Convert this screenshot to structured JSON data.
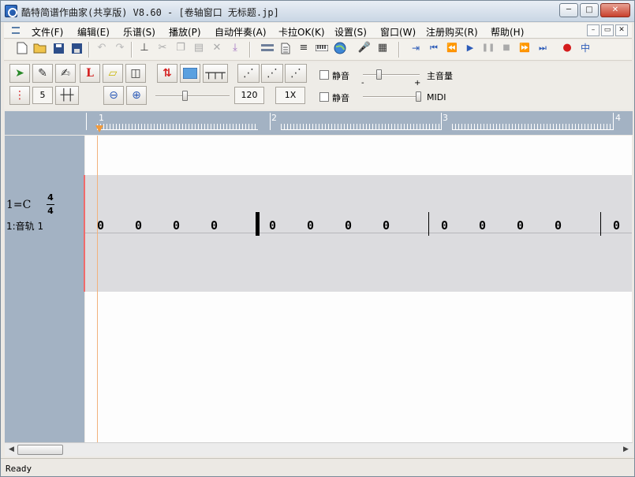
{
  "window": {
    "title": "酷特简谱作曲家(共享版) V8.60 - [卷轴窗口  无标题.jp]",
    "controls": [
      "─",
      "□",
      "✕"
    ]
  },
  "menubar": {
    "items": [
      "文件(F)",
      "编辑(E)",
      "乐谱(S)",
      "播放(P)",
      "自动伴奏(A)",
      "卡拉OK(K)",
      "设置(S)",
      "窗口(W)",
      "注册购买(R)",
      "帮助(H)"
    ],
    "mdi_controls": [
      "–",
      "▭",
      "✕"
    ]
  },
  "toolbar2": {
    "grid_value": "5",
    "tempo_value": "120",
    "speed_value": "1X",
    "mute1_label": "静音",
    "mute2_label": "静音",
    "master_volume_label": "主音量",
    "midi_label": "MIDI",
    "minus_label": "-",
    "plus_label": "+"
  },
  "ruler": {
    "measures": [
      "1",
      "2",
      "3",
      "4"
    ]
  },
  "track": {
    "key": "1=C",
    "time_num": "4",
    "time_den": "4",
    "name": "1:音轨 1"
  },
  "score": {
    "notes": [
      "0",
      "0",
      "0",
      "0",
      "0",
      "0",
      "0",
      "0",
      "0",
      "0",
      "0",
      "0",
      "0"
    ]
  },
  "statusbar": {
    "text": "Ready"
  },
  "colors": {
    "panel": "#a3b2c3",
    "track_band": "#dcdcdf",
    "playhead": "#f2b27c",
    "track_marker": "#f06b6b"
  }
}
